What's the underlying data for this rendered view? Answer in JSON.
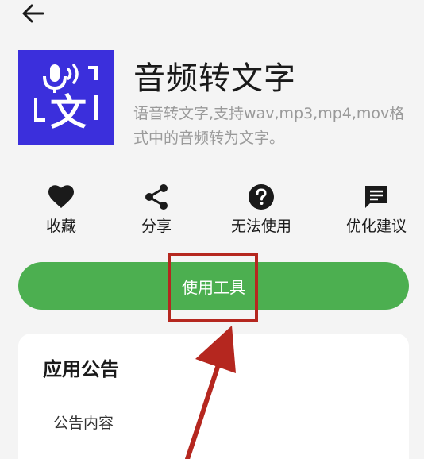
{
  "header": {
    "back_icon": "arrow-left-icon"
  },
  "app": {
    "icon": "voice-to-text-icon",
    "icon_glyph": "文",
    "icon_bg": "#3b2fdc",
    "title": "音频转文字",
    "description": "语音转文字,支持wav,mp3,mp4,mov格式中的音频转为文字。"
  },
  "actions": [
    {
      "label": "收藏",
      "icon": "heart-icon"
    },
    {
      "label": "分享",
      "icon": "share-icon"
    },
    {
      "label": "无法使用",
      "icon": "help-circle-icon"
    },
    {
      "label": "优化建议",
      "icon": "feedback-icon"
    }
  ],
  "primary_button": {
    "label": "使用工具",
    "color": "#4caf50"
  },
  "announcement": {
    "title": "应用公告",
    "content": "公告内容"
  },
  "annotation": {
    "color": "#b5271f"
  }
}
